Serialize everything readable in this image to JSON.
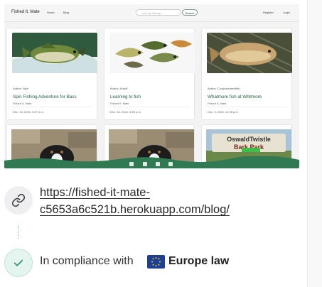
{
  "site": {
    "brand": "Fished It, Mate",
    "nav_links": [
      "Home",
      "Blog"
    ],
    "search_placeholder": "Lets go fishing",
    "search_button": "Search",
    "auth_links": [
      "Register",
      "Login"
    ]
  },
  "posts": [
    {
      "author": "Author: Noel",
      "title": "Spin Fishing Adventure for Bass",
      "site": "Fished It, Mate",
      "date": "Dec. 10, 2024, 5:57 p.m."
    },
    {
      "author": "Author: AmyR",
      "title": "Learning to fish",
      "site": "Fished It, Mate",
      "date": "Dec. 10, 2024, 4:55 p.m."
    },
    {
      "author": "Author: Coolpickmeedfish",
      "title": "Whatmore fish at Whitmore",
      "site": "Fished It, Mate",
      "date": "Dec. 9, 2024, 12:05 p.m."
    }
  ],
  "bark_park": {
    "line1": "OswaldTwistle",
    "line2": "Bark Park"
  },
  "link": {
    "line1": "https://fished-it-mate-",
    "line2": "c5653a6c521b.herokuapp.com/blog/"
  },
  "compliance": {
    "prefix": "In compliance with",
    "region": "Europe law"
  },
  "colors": {
    "accent_green": "#2f7a52",
    "link_blue": "#7fb0d8",
    "eu_blue": "#1d3f94",
    "eu_star": "#f7d117"
  }
}
